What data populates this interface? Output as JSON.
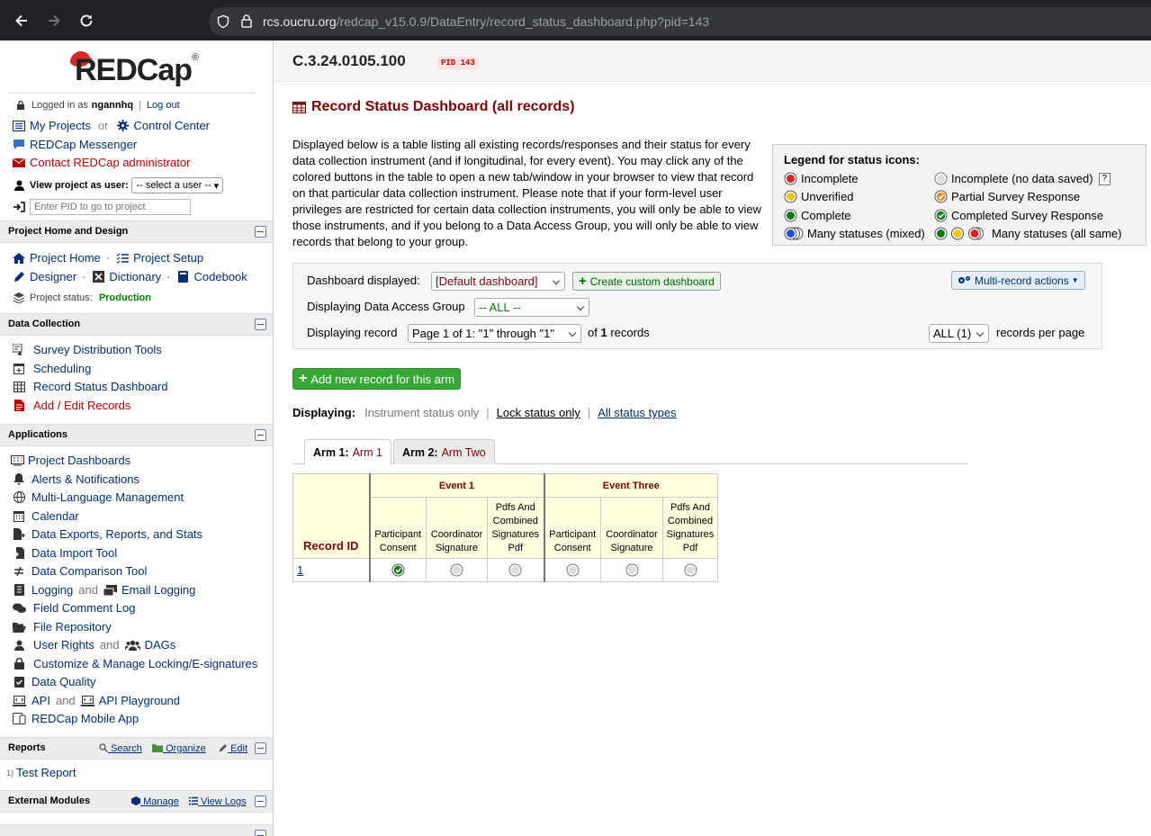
{
  "browser": {
    "url_host": "rcs.oucru.org",
    "url_path": "/redcap_v15.0.9/DataEntry/record_status_dashboard.php?pid=143"
  },
  "sidebar": {
    "logo_text": "REDCap",
    "logged_in_prefix": "Logged in as",
    "username": "ngannhq",
    "logout": "Log out",
    "my_projects": "My Projects",
    "or": "or",
    "control_center": "Control Center",
    "messenger": "REDCap Messenger",
    "contact_admin": "Contact REDCap administrator",
    "view_as_user_label": "View project as user:",
    "view_as_user_value": "-- select a user --",
    "pid_placeholder": "Enter PID to go to project",
    "sections": {
      "project_home": {
        "title": "Project Home and Design",
        "project_home": "Project Home",
        "project_setup": "Project Setup",
        "designer": "Designer",
        "dictionary": "Dictionary",
        "codebook": "Codebook",
        "status_label": "Project status:",
        "status_value": "Production"
      },
      "data_collection": {
        "title": "Data Collection",
        "items": [
          "Survey Distribution Tools",
          "Scheduling",
          "Record Status Dashboard",
          "Add / Edit Records"
        ]
      },
      "applications": {
        "title": "Applications",
        "project_dashboards": "Project Dashboards",
        "alerts": "Alerts & Notifications",
        "mlm": "Multi-Language Management",
        "calendar": "Calendar",
        "exports": "Data Exports, Reports, and Stats",
        "import": "Data Import Tool",
        "comparison": "Data Comparison Tool",
        "logging": "Logging",
        "and": "and",
        "email_logging": "Email Logging",
        "field_comment": "Field Comment Log",
        "file_repo": "File Repository",
        "user_rights": "User Rights",
        "dags": "DAGs",
        "locking": "Customize & Manage Locking/E-signatures",
        "data_quality": "Data Quality",
        "api": "API",
        "api_playground": "API Playground",
        "mobile_app": "REDCap Mobile App"
      },
      "reports": {
        "title": "Reports",
        "search": "Search",
        "organize": "Organize",
        "edit": "Edit",
        "report_num": "1)",
        "report_name": "Test Report"
      },
      "external_modules": {
        "title": "External Modules",
        "manage": "Manage",
        "view_logs": "View Logs"
      }
    }
  },
  "main": {
    "project_title": "C.3.24.0105.100",
    "pid_badge": "PID 143",
    "page_title": "Record Status Dashboard (all records)",
    "intro": "Displayed below is a table listing all existing records/responses and their status for every data collection instrument (and if longitudinal, for every event). You may click any of the colored buttons in the table to open a new tab/window in your browser to view that record on that particular data collection instrument. Please note that if your form-level user privileges are restricted for certain data collection instruments, you will only be able to view those instruments, and if you belong to a Data Access Group, you will only be able to view records that belong to your group.",
    "legend": {
      "title": "Legend for status icons:",
      "incomplete": "Incomplete",
      "unverified": "Unverified",
      "complete": "Complete",
      "many_mixed": "Many statuses (mixed)",
      "incomplete_nodata": "Incomplete (no data saved)",
      "help": "?",
      "partial": "Partial Survey Response",
      "completed_survey": "Completed Survey Response",
      "many_same": "Many statuses (all same)"
    },
    "dashboard": {
      "displayed_label": "Dashboard displayed:",
      "displayed_value": "[Default dashboard]",
      "create_custom": "Create custom dashboard",
      "multi_record": "Multi-record actions",
      "dag_label": "Displaying Data Access Group",
      "dag_value": "-- ALL --",
      "record_label": "Displaying record",
      "record_value": "Page 1 of 1: \"1\" through \"1\"",
      "of": "of",
      "record_count": "1",
      "records": "records",
      "per_page_value": "ALL (1)",
      "per_page_label": "records per page"
    },
    "add_record": "Add new record for this arm",
    "displaying": {
      "label": "Displaying:",
      "instrument_only": "Instrument status only",
      "lock_only": "Lock status only",
      "all_types": "All status types"
    },
    "tabs": [
      {
        "arm": "Arm 1:",
        "name": "Arm 1"
      },
      {
        "arm": "Arm 2:",
        "name": "Arm Two"
      }
    ],
    "grid": {
      "record_id_header": "Record ID",
      "events": [
        "Event 1",
        "Event Three"
      ],
      "forms": [
        "Participant Consent",
        "Coordinator Signature",
        "Pdfs And Combined Signatures Pdf",
        "Participant Consent",
        "Coordinator Signature",
        "Pdfs And Combined Signatures Pdf"
      ],
      "rows": [
        {
          "id": "1",
          "statuses": [
            "completed-survey",
            "gray",
            "gray",
            "gray",
            "gray",
            "gray"
          ]
        }
      ]
    }
  },
  "colors": {
    "maroon": "#800000",
    "link": "#00307a",
    "green_button": "#35a835",
    "production": "#008000"
  }
}
